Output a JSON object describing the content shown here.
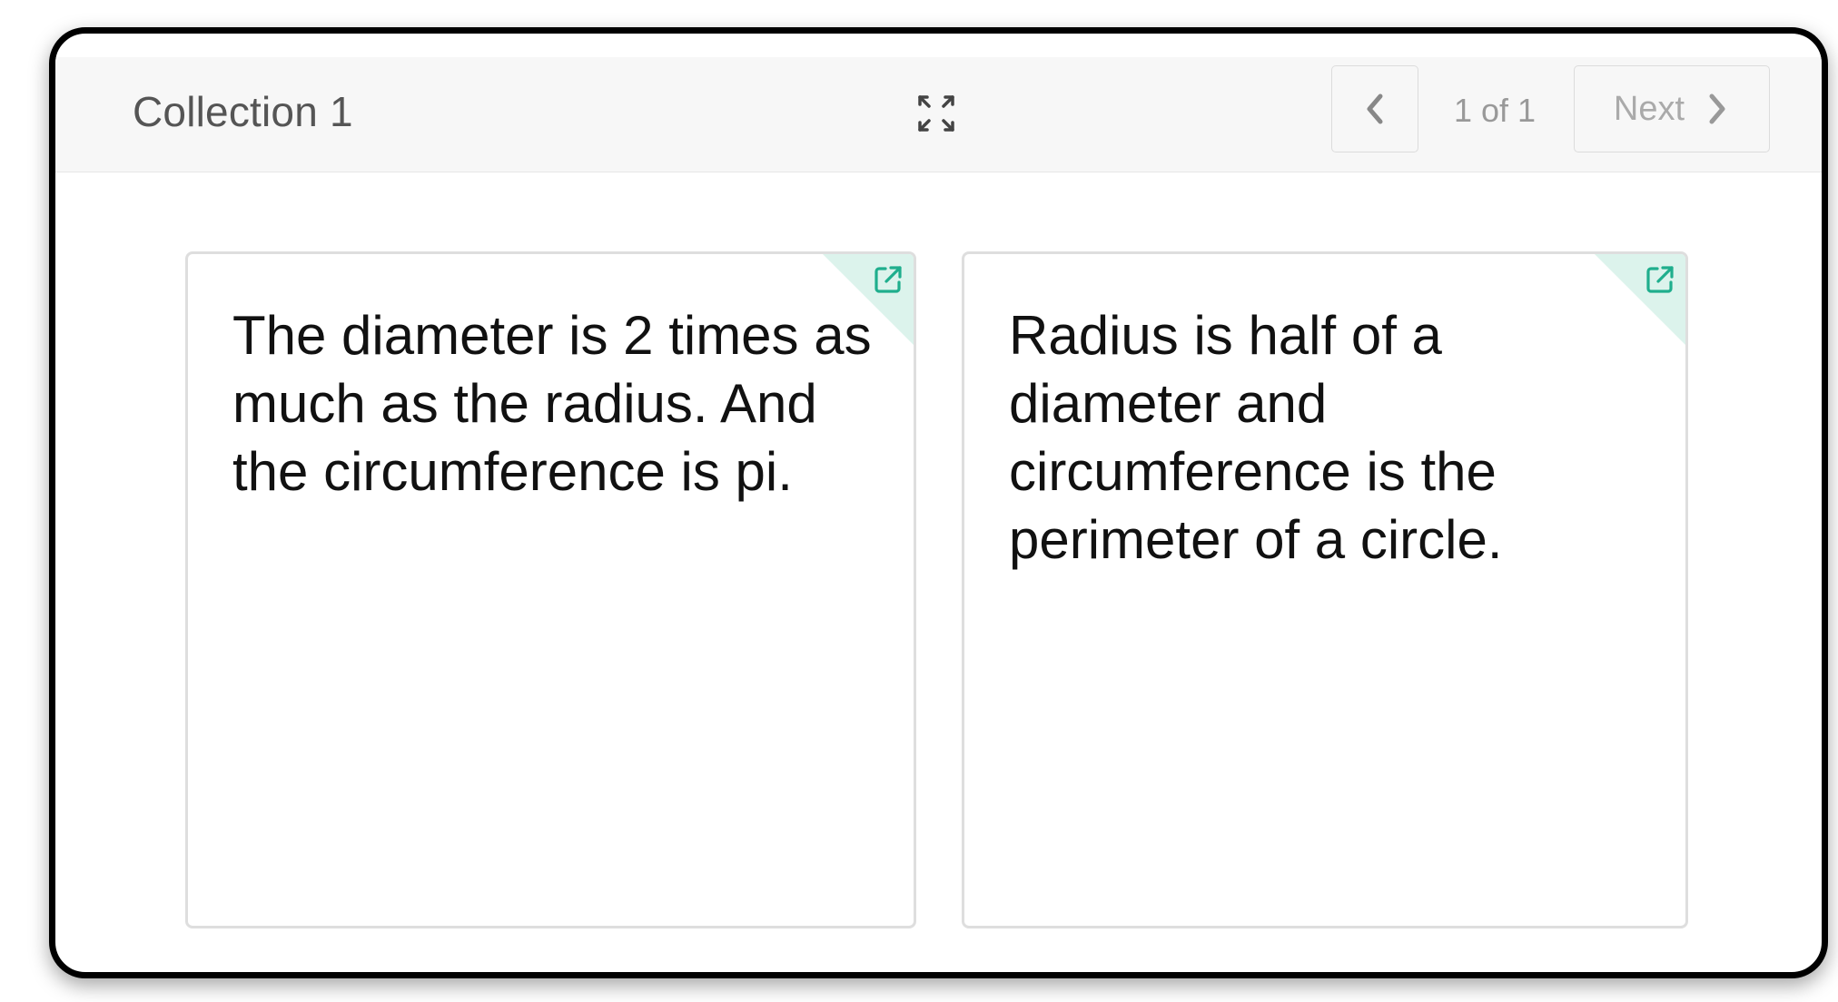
{
  "header": {
    "title": "Collection 1",
    "expand_icon": "expand-arrows-icon",
    "pager": {
      "prev_icon": "chevron-left-icon",
      "page_text": "1 of 1",
      "next_label": "Next",
      "next_icon": "chevron-right-icon"
    }
  },
  "cards": [
    {
      "text": "The diameter is 2 times as much as the radius. And the circumference is pi.",
      "open_icon": "external-link-icon"
    },
    {
      "text": "Radius is half of a diameter and circumference is the perimeter of a circle.",
      "open_icon": "external-link-icon"
    }
  ],
  "colors": {
    "accent": "#1fae8d",
    "corner_tint": "#dcf3ec",
    "header_bg": "#f7f7f7"
  }
}
